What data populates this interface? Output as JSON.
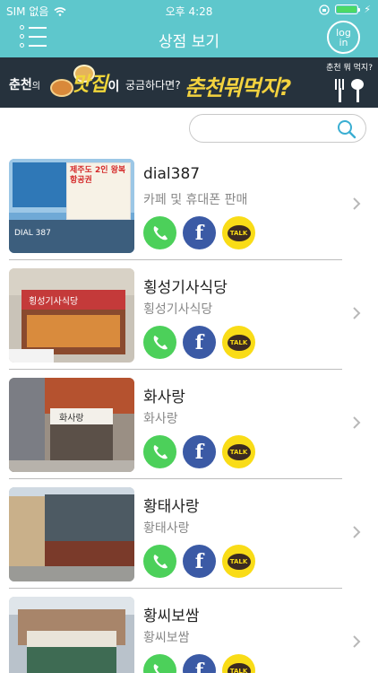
{
  "status": {
    "carrier": "SIM 없음",
    "time": "오후 4:28"
  },
  "nav": {
    "title": "상점 보기",
    "login_line1": "log",
    "login_line2": "in"
  },
  "banner": {
    "city": "춘천",
    "particle": "의",
    "big": "맛집",
    "particle2": "이",
    "question": "궁금하다면?",
    "brand": "춘천뭐먹지?",
    "side": "춘천 뭐 먹지?"
  },
  "search": {
    "value": "",
    "placeholder": ""
  },
  "stores": [
    {
      "name": "dial387",
      "category": "카페 및 휴대폰 판매",
      "sign": "DIAL 387",
      "poster": "제주도 2인 왕복항공권"
    },
    {
      "name": "횡성기사식당",
      "category": "횡성기사식당",
      "sign": "횡성기사식당"
    },
    {
      "name": "화사랑",
      "category": "화사랑",
      "sign": "화사랑"
    },
    {
      "name": "황태사랑",
      "category": "황태사랑"
    },
    {
      "name": "황씨보쌈",
      "category": "황씨보쌈"
    }
  ],
  "colors": {
    "nav": "#5ec7cc",
    "call": "#4cd05a",
    "facebook": "#3b5aa5",
    "kakao": "#f9dc17"
  },
  "icons": {
    "call": "phone-icon",
    "facebook": "facebook-icon",
    "kakao": "kakaotalk-icon",
    "chevron": "chevron-right-icon"
  },
  "talk_label": "TALK",
  "fb_label": "f"
}
